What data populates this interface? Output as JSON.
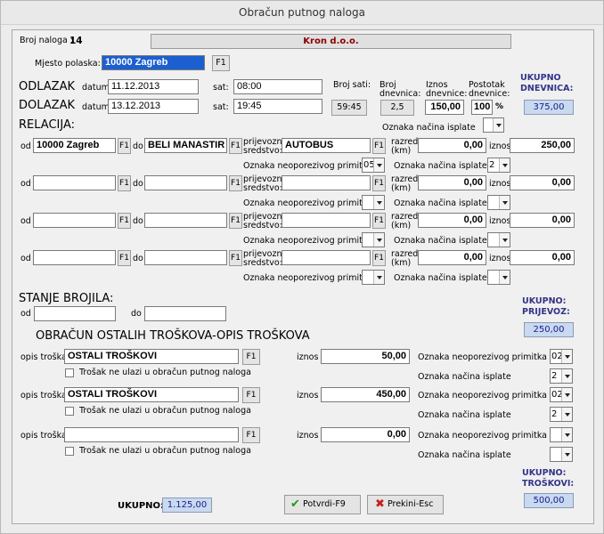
{
  "window_title": "Obračun putnog naloga",
  "broj_naloga": {
    "label": "Broj naloga :",
    "value": "14"
  },
  "company": "Kron d.o.o.",
  "mjesto": {
    "label": "Mjesto polaska:",
    "value": "10000 Zagreb",
    "key": "F1"
  },
  "odlazak": {
    "label": "ODLAZAK",
    "datum_label": "datum:",
    "datum": "11.12.2013",
    "sat_label": "sat:",
    "sat": "08:00"
  },
  "dolazak": {
    "label": "DOLAZAK",
    "datum_label": "datum:",
    "datum": "13.12.2013",
    "sat_label": "sat:",
    "sat": "19:45"
  },
  "broj_sati": {
    "label": "Broj sati:",
    "value": "59:45"
  },
  "broj_dnevnica": {
    "label1": "Broj",
    "label2": "dnevnica:",
    "value": "2,5"
  },
  "iznos_dnevnice": {
    "label1": "Iznos",
    "label2": "dnevnice:",
    "value": "150,00"
  },
  "postotak": {
    "label1": "Postotak",
    "label2": "dnevnice:",
    "value": "100",
    "unit": "%"
  },
  "ukupno_dnevnica": {
    "label1": "UKUPNO",
    "label2": "DNEVNICA:",
    "value": "375,00"
  },
  "oznaka_nacina_isplate_top": {
    "label": "Oznaka načina isplate",
    "value": ""
  },
  "relacija": {
    "title": "RELACIJA:",
    "labels": {
      "od": "od",
      "do": "do",
      "key": "F1",
      "prijevozno1": "prijevozno",
      "prijevozno2": "sredstvo:",
      "razred1": "razred",
      "razred2": "(km)",
      "iznos": "iznos",
      "neoporezivog": "Oznaka neoporezivog primitka",
      "nacin": "Oznaka načina isplate"
    },
    "rows": [
      {
        "od": "10000 Zagreb",
        "do": "BELI MANASTIR",
        "sredstvo": "AUTOBUS",
        "razred": "0,00",
        "iznos": "250,00",
        "neoporezivog": "05",
        "nacin": "2"
      },
      {
        "od": "",
        "do": "",
        "sredstvo": "",
        "razred": "0,00",
        "iznos": "0,00",
        "neoporezivog": "",
        "nacin": ""
      },
      {
        "od": "",
        "do": "",
        "sredstvo": "",
        "razred": "0,00",
        "iznos": "0,00",
        "neoporezivog": "",
        "nacin": ""
      },
      {
        "od": "",
        "do": "",
        "sredstvo": "",
        "razred": "0,00",
        "iznos": "0,00",
        "neoporezivog": "",
        "nacin": ""
      }
    ]
  },
  "ukupno_prijevoz": {
    "label1": "UKUPNO:",
    "label2": "PRIJEVOZ:",
    "value": "250,00"
  },
  "stanje_brojila": {
    "title": "STANJE BROJILA:",
    "od_label": "od",
    "od": "",
    "do_label": "do",
    "do": ""
  },
  "troskovi": {
    "title": "OBRAČUN OSTALIH TROŠKOVA-OPIS TROŠKOVA",
    "labels": {
      "opis": "opis troška",
      "key": "F1",
      "iznos": "iznos",
      "checkbox": "Trošak ne ulazi u obračun putnog naloga",
      "neoporezivog": "Oznaka neoporezivog primitka",
      "nacin": "Oznaka načina isplate"
    },
    "rows": [
      {
        "opis": "OSTALI TROŠKOVI",
        "iznos": "50,00",
        "neoporezivog": "02",
        "nacin": "2"
      },
      {
        "opis": "OSTALI TROŠKOVI",
        "iznos": "450,00",
        "neoporezivog": "02",
        "nacin": "2"
      },
      {
        "opis": "",
        "iznos": "0,00",
        "neoporezivog": "",
        "nacin": ""
      }
    ]
  },
  "ukupno_troskovi": {
    "label1": "UKUPNO:",
    "label2": "TROŠKOVI:",
    "value": "500,00"
  },
  "ukupno": {
    "label": "UKUPNO:",
    "value": "1.125,00"
  },
  "buttons": {
    "potvrdi": "Potvrdi-F9",
    "prekini": "Prekini-Esc"
  },
  "colors": {
    "accent_blue": "#33338a",
    "company_red": "#8a0000",
    "total_bg": "#c9daf0",
    "confirm_green": "#1e9a1e",
    "cancel_red": "#c81e1e"
  }
}
